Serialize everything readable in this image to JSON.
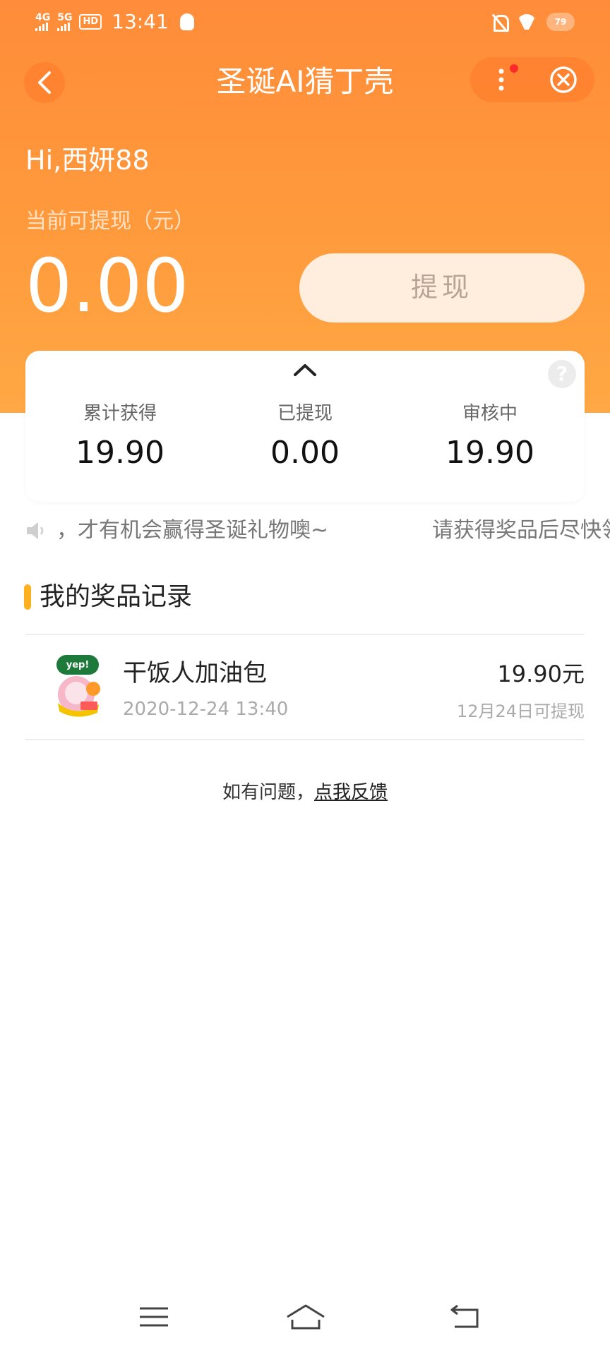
{
  "status_bar": {
    "net1": "4G",
    "net2": "5G",
    "hd": "HD",
    "time": "13:41",
    "battery": "79"
  },
  "nav": {
    "title": "圣诞AI猜丁壳"
  },
  "greeting": "Hi,西妍88",
  "balance": {
    "label": "当前可提现（元）",
    "amount": "0.00",
    "withdraw_label": "提现"
  },
  "stats": [
    {
      "label": "累计获得",
      "value": "19.90"
    },
    {
      "label": "已提现",
      "value": "0.00"
    },
    {
      "label": "审核中",
      "value": "19.90"
    }
  ],
  "marquee": {
    "text1": "，才有机会赢得圣诞礼物噢~",
    "text2": "请获得奖品后尽快领"
  },
  "records": {
    "section_title": "我的奖品记录",
    "items": [
      {
        "name": "干饭人加油包",
        "date": "2020-12-24 13:40",
        "amount": "19.90元",
        "note": "12月24日可提现",
        "thumb_brand": "yep!"
      }
    ]
  },
  "feedback": {
    "prefix": "如有问题，",
    "link": "点我反馈"
  },
  "colors": {
    "header_orange": "#ff9a3c",
    "accent_yellow": "#ffb020",
    "withdraw_bg": "#ffeedd"
  }
}
